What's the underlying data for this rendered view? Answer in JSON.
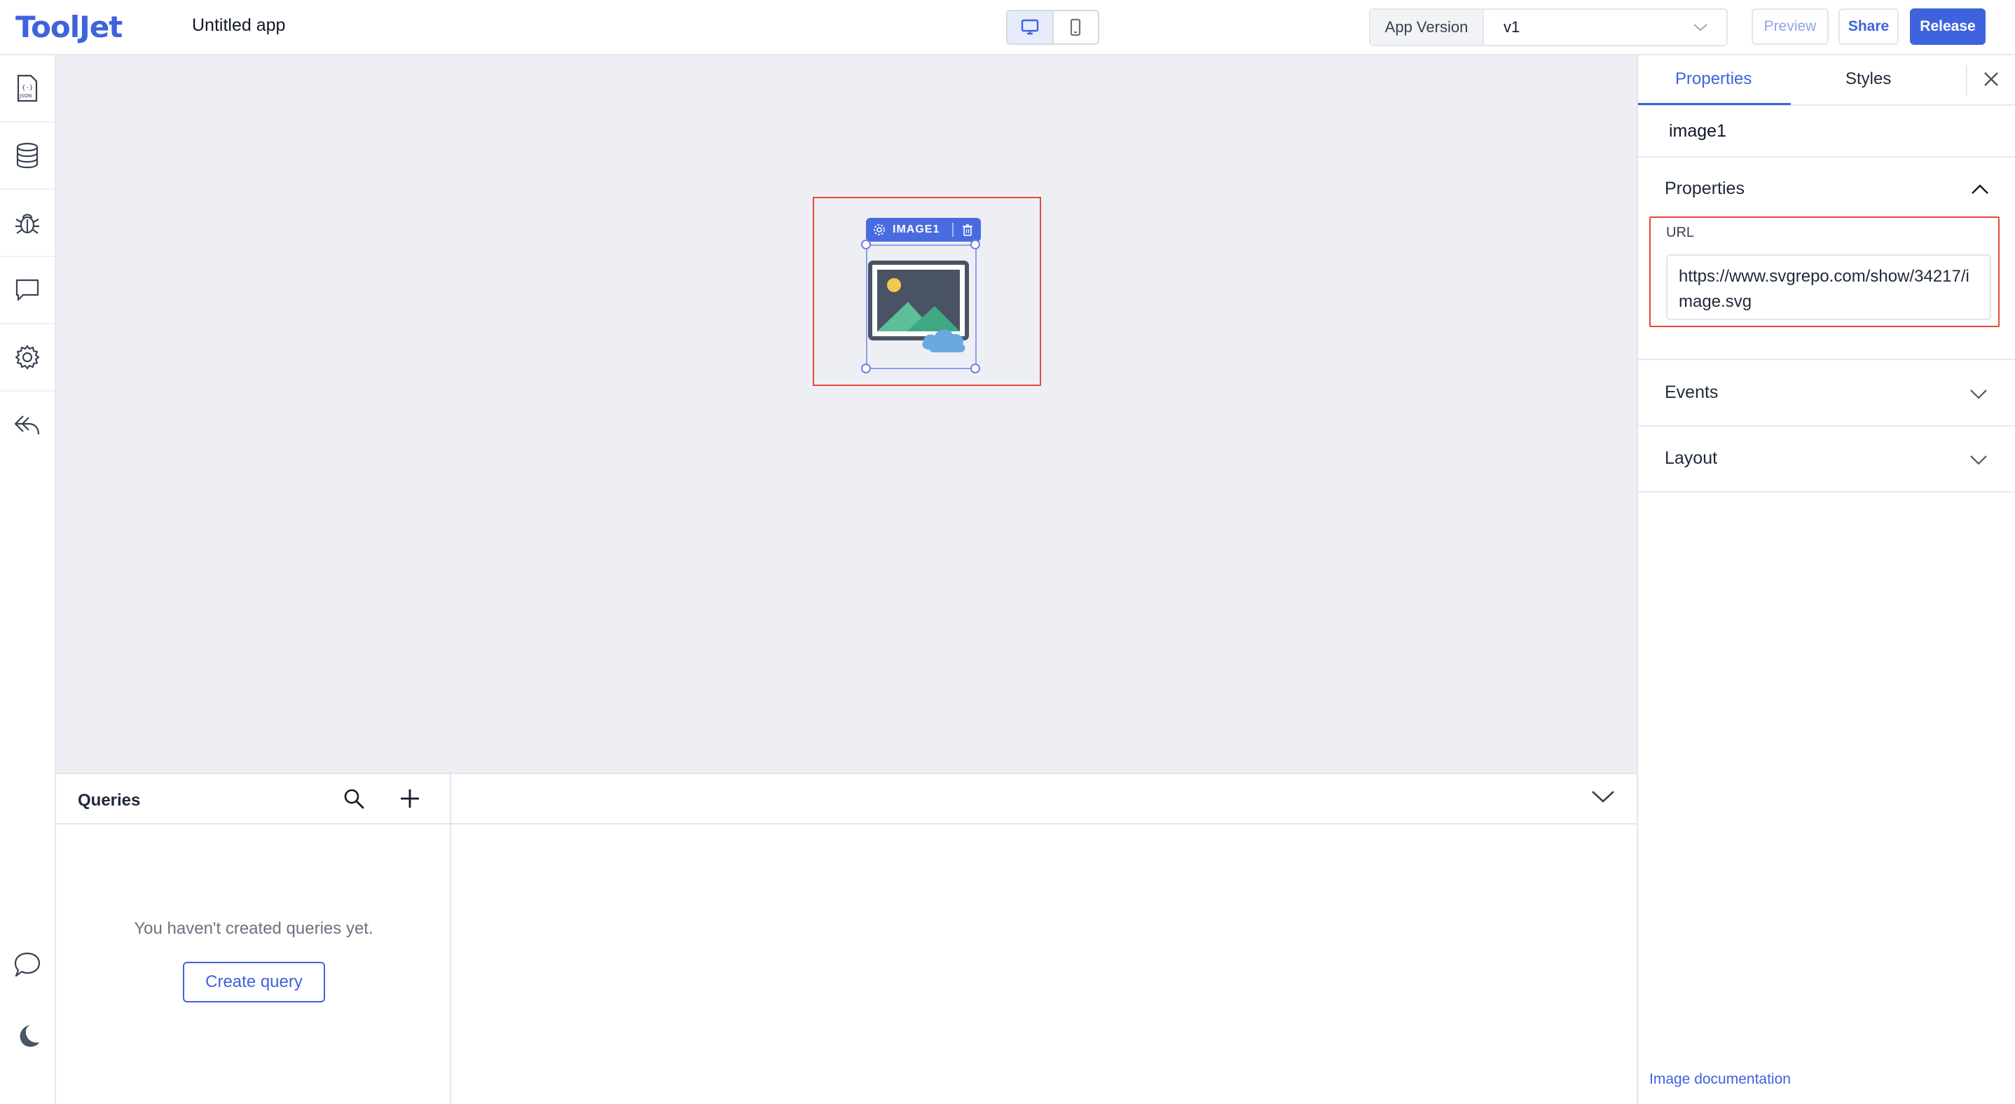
{
  "header": {
    "logo": "ToolJet",
    "app_name": "Untitled app",
    "version_label": "App Version",
    "version_value": "v1",
    "preview_label": "Preview",
    "share_label": "Share",
    "release_label": "Release"
  },
  "sidebar": {
    "items": [
      "json-inspector-icon",
      "database-icon",
      "debugger-icon",
      "comments-icon",
      "settings-icon",
      "back-icon"
    ],
    "bottom": [
      "chat-icon",
      "dark-mode-icon"
    ]
  },
  "canvas": {
    "widget_label": "IMAGE1"
  },
  "queries": {
    "title": "Queries",
    "empty_text": "You haven't created queries yet.",
    "create_label": "Create query"
  },
  "inspector": {
    "tab_properties": "Properties",
    "tab_styles": "Styles",
    "component_name": "image1",
    "section_properties": "Properties",
    "url_label": "URL",
    "url_value": "https://www.svgrepo.com/show/34217/image.svg",
    "section_events": "Events",
    "section_layout": "Layout",
    "doc_link": "Image documentation"
  },
  "colors": {
    "accent": "#3e63dd",
    "highlight": "#e5483a",
    "canvas_bg": "#eeeff4"
  }
}
